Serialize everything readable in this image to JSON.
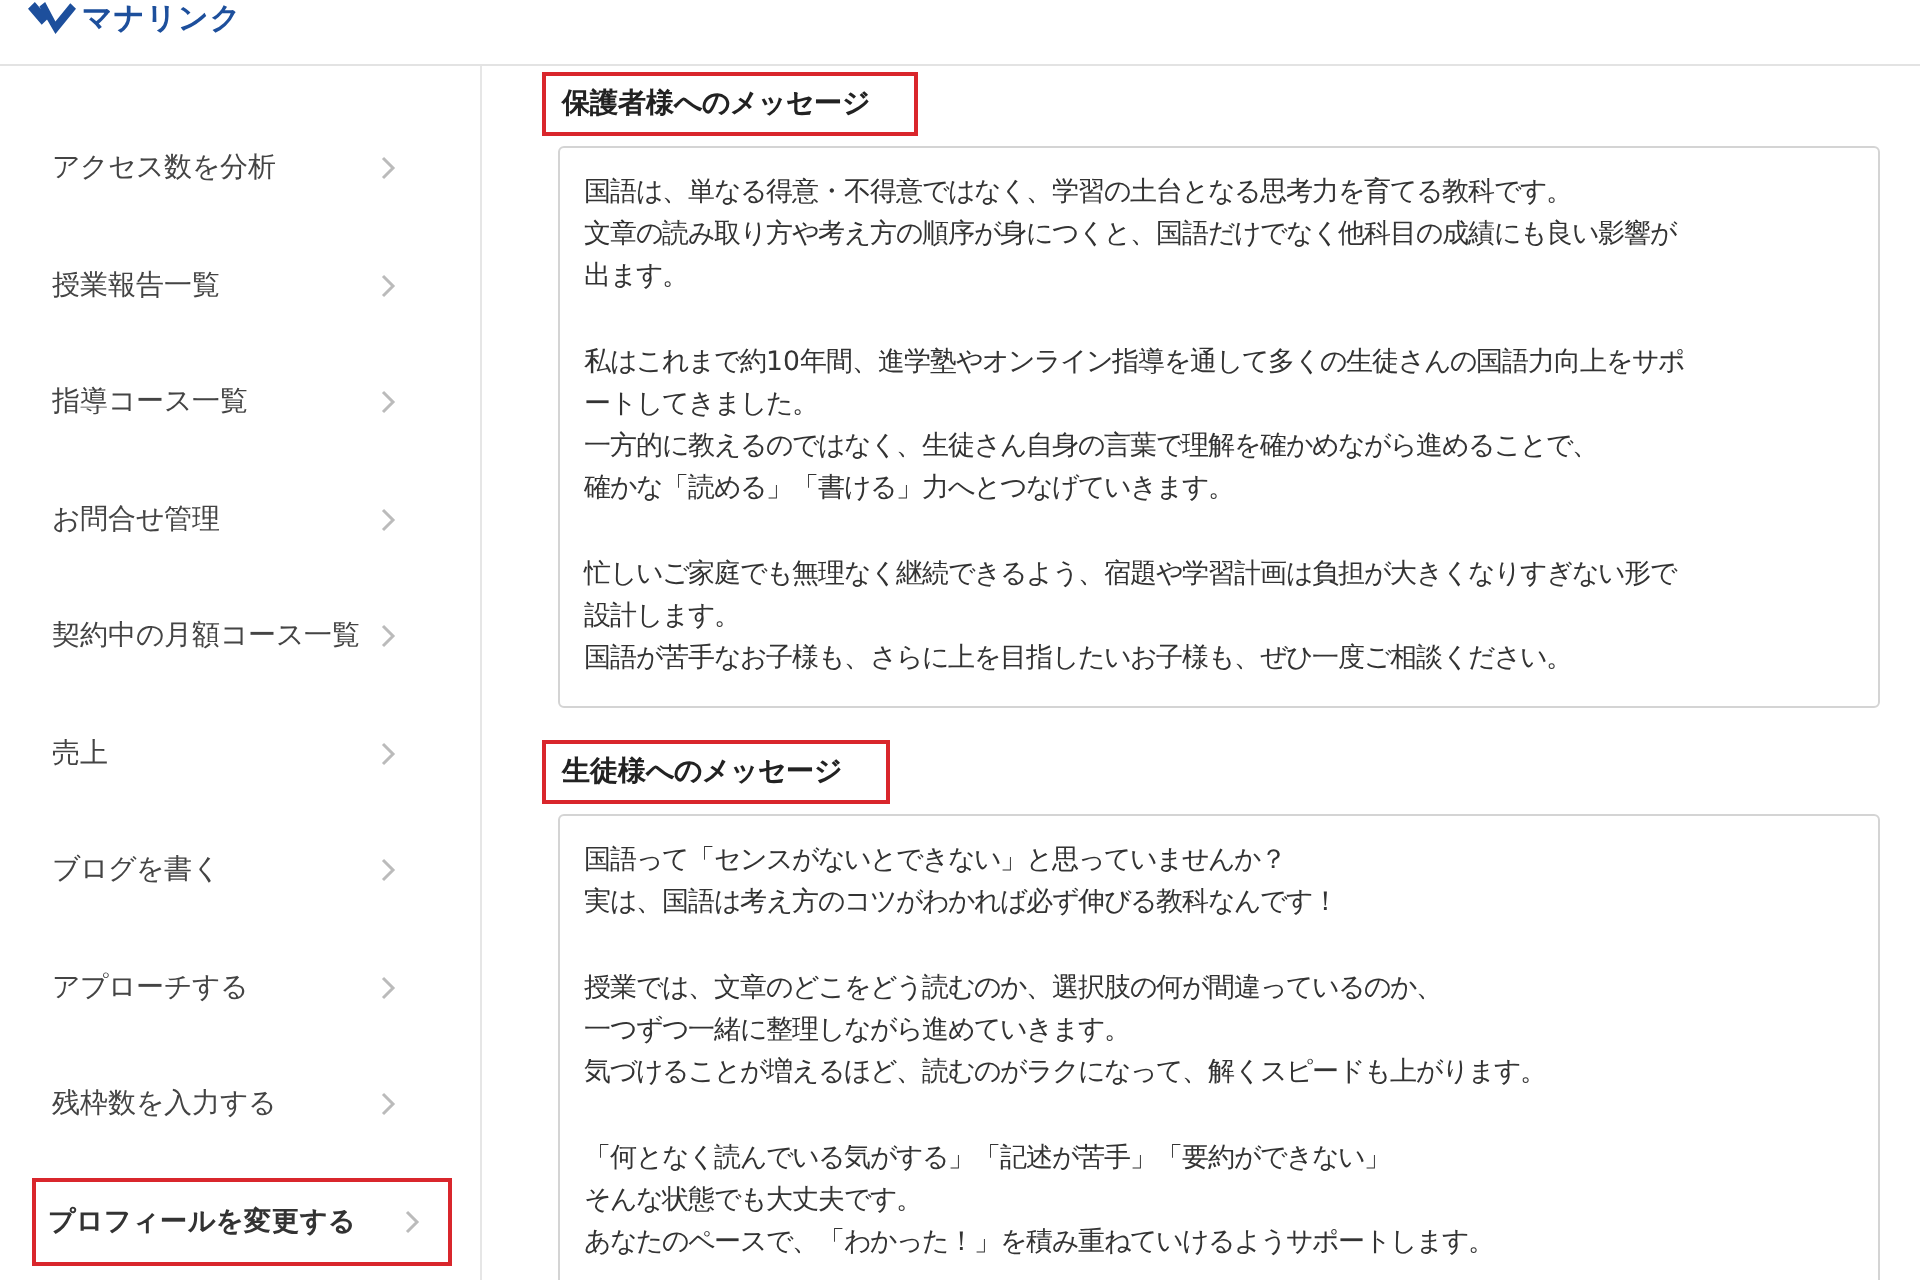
{
  "header": {
    "logo_text": "マナリンク"
  },
  "sidebar": {
    "items": [
      {
        "label": "アクセス数を分析",
        "selected": false
      },
      {
        "label": "授業報告一覧",
        "selected": false
      },
      {
        "label": "指導コース一覧",
        "selected": false
      },
      {
        "label": "お問合せ管理",
        "selected": false
      },
      {
        "label": "契約中の月額コース一覧",
        "selected": false
      },
      {
        "label": "売上",
        "selected": false
      },
      {
        "label": "ブログを書く",
        "selected": false
      },
      {
        "label": "アプローチする",
        "selected": false
      },
      {
        "label": "残枠数を入力する",
        "selected": false
      },
      {
        "label": "プロフィールを変更する",
        "selected": true
      }
    ]
  },
  "sections": [
    {
      "heading": "保護者様へのメッセージ",
      "highlighted": true,
      "paragraphs": [
        [
          "国語は、単なる得意・不得意ではなく、学習の土台となる思考力を育てる教科です。",
          "文章の読み取り方や考え方の順序が身につくと、国語だけでなく他科目の成績にも良い影響が",
          "出ます。"
        ],
        [
          "私はこれまで約10年間、進学塾やオンライン指導を通して多くの生徒さんの国語力向上をサポ",
          "ートしてきました。",
          "一方的に教えるのではなく、生徒さん自身の言葉で理解を確かめながら進めることで、",
          "確かな「読める」「書ける」力へとつなげていきます。"
        ],
        [
          "忙しいご家庭でも無理なく継続できるよう、宿題や学習計画は負担が大きくなりすぎない形で",
          "設計します。",
          "国語が苦手なお子様も、さらに上を目指したいお子様も、ぜひ一度ご相談ください。"
        ]
      ]
    },
    {
      "heading": "生徒様へのメッセージ",
      "highlighted": true,
      "paragraphs": [
        [
          "国語って「センスがないとできない」と思っていませんか？",
          "実は、国語は考え方のコツがわかれば必ず伸びる教科なんです！"
        ],
        [
          "授業では、文章のどこをどう読むのか、選択肢の何が間違っているのか、",
          "一つずつ一緒に整理しながら進めていきます。",
          "気づけることが増えるほど、読むのがラクになって、解くスピードも上がります。"
        ],
        [
          "「何となく読んでいる気がする」「記述が苦手」「要約ができない」",
          "そんな状態でも大丈夫です。",
          "あなたのペースで、「わかった！」を積み重ねていけるようサポートします。"
        ]
      ]
    }
  ]
}
